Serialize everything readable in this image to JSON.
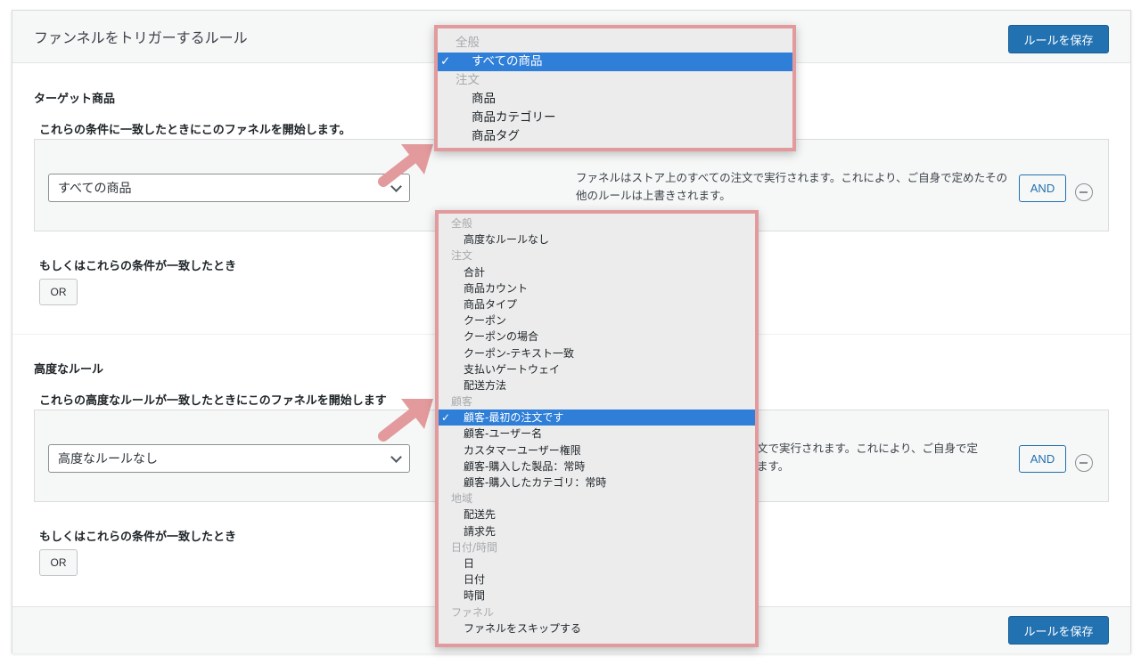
{
  "panel": {
    "title": "ファンネルをトリガーするルール",
    "save_label": "ルールを保存"
  },
  "target": {
    "section_label": "ターゲット商品",
    "condition_label": "これらの条件に一致したときにこのファネルを開始します。",
    "select_value": "すべての商品",
    "description": "ファネルはストア上のすべての注文で実行されます。これにより、ご自身で定めたその他のルールは上書きされます。",
    "and_label": "AND",
    "or_condition_label": "もしくはこれらの条件が一致したとき",
    "or_label": "OR"
  },
  "advanced": {
    "section_label": "高度なルール",
    "condition_label": "これらの高度なルールが一致したときにこのファネルを開始します",
    "select_value": "高度なルールなし",
    "description_partial": "文で実行されます。これにより、ご自身で定",
    "description_partial2": "ます。",
    "and_label": "AND",
    "or_condition_label": "もしくはこれらの条件が一致したとき",
    "or_label": "OR"
  },
  "dropdown_top": {
    "check": "✓",
    "items": [
      {
        "type": "group",
        "label": "全般"
      },
      {
        "type": "item",
        "label": "すべての商品",
        "selected": true
      },
      {
        "type": "group",
        "label": "注文"
      },
      {
        "type": "item",
        "label": "商品"
      },
      {
        "type": "item",
        "label": "商品カテゴリー"
      },
      {
        "type": "item",
        "label": "商品タグ"
      }
    ]
  },
  "dropdown_bottom": {
    "check": "✓",
    "items": [
      {
        "type": "group",
        "label": "全般"
      },
      {
        "type": "item",
        "label": "高度なルールなし"
      },
      {
        "type": "group",
        "label": "注文"
      },
      {
        "type": "item",
        "label": "合計"
      },
      {
        "type": "item",
        "label": "商品カウント"
      },
      {
        "type": "item",
        "label": "商品タイプ"
      },
      {
        "type": "item",
        "label": "クーポン"
      },
      {
        "type": "item",
        "label": "クーポンの場合"
      },
      {
        "type": "item",
        "label": "クーポン-テキスト一致"
      },
      {
        "type": "item",
        "label": "支払いゲートウェイ"
      },
      {
        "type": "item",
        "label": "配送方法"
      },
      {
        "type": "group",
        "label": "顧客"
      },
      {
        "type": "item",
        "label": "顧客-最初の注文です",
        "selected": true
      },
      {
        "type": "item",
        "label": "顧客-ユーザー名"
      },
      {
        "type": "item",
        "label": "カスタマーユーザー権限"
      },
      {
        "type": "item",
        "label": "顧客-購入した製品：常時"
      },
      {
        "type": "item",
        "label": "顧客-購入したカテゴリ：常時"
      },
      {
        "type": "group",
        "label": "地域"
      },
      {
        "type": "item",
        "label": "配送先"
      },
      {
        "type": "item",
        "label": "請求先"
      },
      {
        "type": "group",
        "label": "日付/時間"
      },
      {
        "type": "item",
        "label": "日"
      },
      {
        "type": "item",
        "label": "日付"
      },
      {
        "type": "item",
        "label": "時間"
      },
      {
        "type": "group",
        "label": "ファネル"
      },
      {
        "type": "item",
        "label": "ファネルをスキップする"
      }
    ]
  },
  "colors": {
    "primary": "#2271b1",
    "highlight": "#2f7fd8",
    "annotation": "#e39a9d"
  }
}
